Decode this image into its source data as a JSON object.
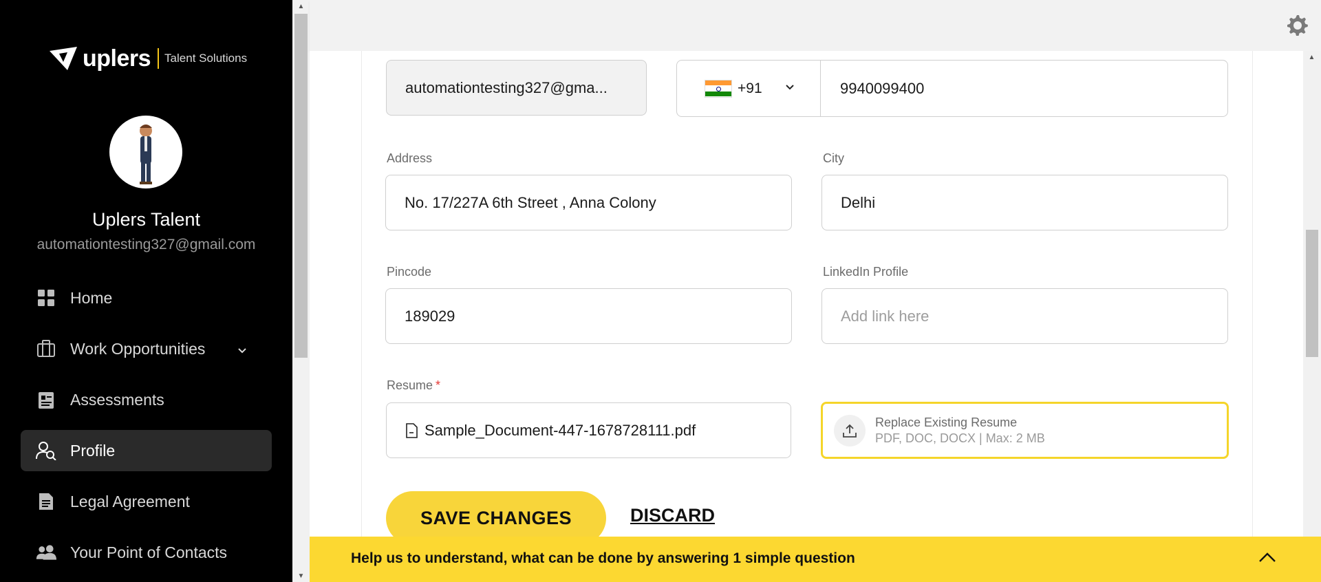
{
  "brand": {
    "logo_text": "uplers",
    "tagline": "Talent Solutions"
  },
  "user": {
    "name": "Uplers Talent",
    "email": "automationtesting327@gmail.com"
  },
  "nav": {
    "items": [
      {
        "label": "Home",
        "icon": "grid-icon"
      },
      {
        "label": "Work Opportunities",
        "icon": "briefcase-icon",
        "has_submenu": true
      },
      {
        "label": "Assessments",
        "icon": "clipboard-icon"
      },
      {
        "label": "Profile",
        "icon": "user-search-icon",
        "active": true
      },
      {
        "label": "Legal Agreement",
        "icon": "document-icon"
      },
      {
        "label": "Your Point of Contacts",
        "icon": "contacts-icon"
      }
    ]
  },
  "form": {
    "email_value": "automationtesting327@gma...",
    "phone_country_code": "+91",
    "phone_number": "9940099400",
    "address_label": "Address",
    "address_value": "No. 17/227A 6th Street , Anna Colony",
    "city_label": "City",
    "city_value": "Delhi",
    "pincode_label": "Pincode",
    "pincode_value": "189029",
    "linkedin_label": "LinkedIn Profile",
    "linkedin_placeholder": "Add link here",
    "resume_label": "Resume",
    "resume_required_mark": "*",
    "resume_file": "Sample_Document-447-1678728111.pdf",
    "upload_title": "Replace Existing Resume",
    "upload_sub": "PDF, DOC, DOCX | Max: 2 MB"
  },
  "actions": {
    "save_label": "SAVE CHANGES",
    "discard_label": "DISCARD"
  },
  "banner": {
    "text": "Help us to understand, what can be done by answering 1 simple question"
  },
  "colors": {
    "accent": "#F8D53A",
    "sidebar_bg": "#000000",
    "required": "#E53935"
  }
}
